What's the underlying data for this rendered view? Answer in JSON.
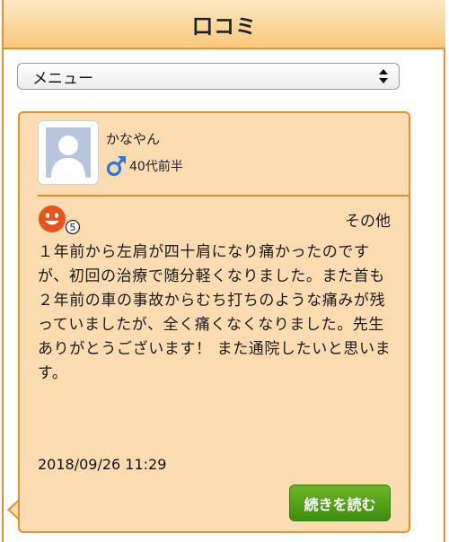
{
  "header": {
    "title": "口コミ"
  },
  "menu": {
    "selected": "メニュー"
  },
  "review": {
    "user_name": "かなやん",
    "gender_icon": "male-icon",
    "age": "40代前半",
    "rating": "5",
    "rating_icon": "smile-face-icon",
    "category": "その他",
    "body": "１年前から左肩が四十肩になり痛かったのですが、初回の治療で随分軽くなりました。また首も２年前の車の事故からむち打ちのような痛みが残っていましたが、全く痛くなくなりました。先生ありがとうございます！ また通院したいと思います。",
    "date": "2018/09/26 11:29",
    "read_more_label": "続きを読む"
  },
  "colors": {
    "border": "#e8902e",
    "card_bg": "#fcdcb0",
    "male_blue": "#2b78d6",
    "button_green": "#4e9c16",
    "rating_orange": "#e8541a"
  }
}
